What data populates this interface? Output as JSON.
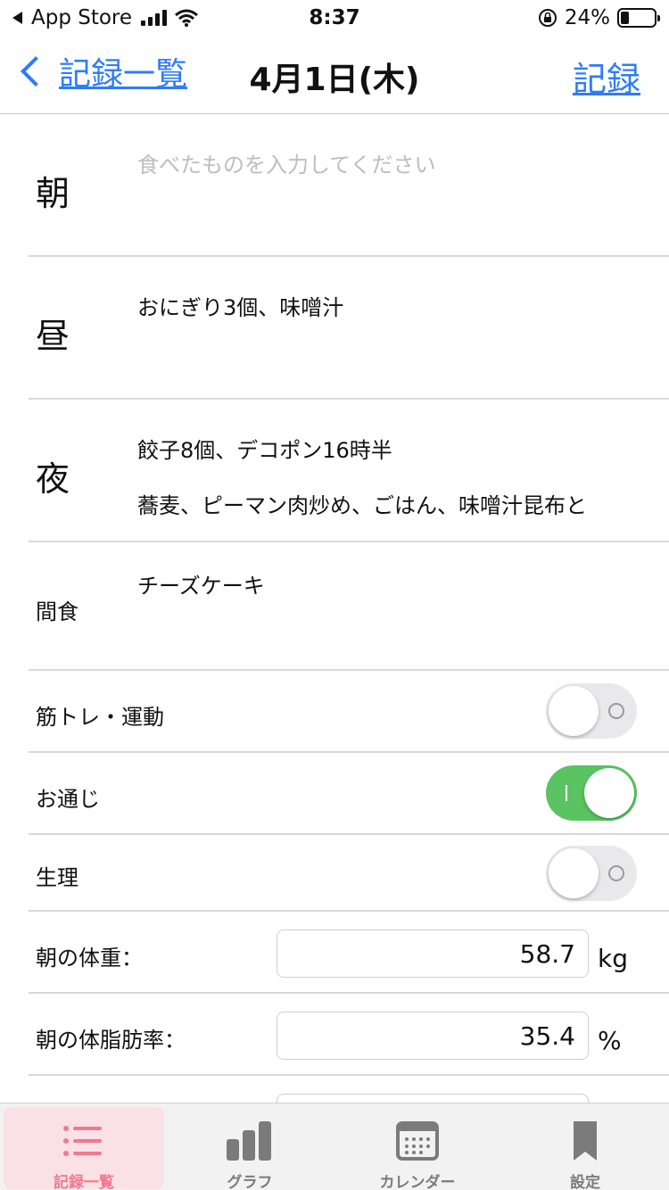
{
  "status_bar": {
    "carrier": "App Store",
    "time": "8:37",
    "battery_percent": "24%",
    "battery_level": 0.24
  },
  "nav": {
    "back_label": "記録一覧",
    "title": "4月1日(木)",
    "action_label": "記録"
  },
  "meals": [
    {
      "label": "朝",
      "lines": [],
      "placeholder": "食べたものを入力してください"
    },
    {
      "label": "昼",
      "lines": [
        "おにぎり3個、味噌汁"
      ]
    },
    {
      "label": "夜",
      "lines": [
        "餃子8個、デコポン16時半",
        "蕎麦、ピーマン肉炒め、ごはん、味噌汁昆布と"
      ]
    },
    {
      "label": "間食",
      "lines": [
        "チーズケーキ"
      ]
    }
  ],
  "toggles": [
    {
      "label": "筋トレ・運動",
      "on": false
    },
    {
      "label": "お通じ",
      "on": true
    },
    {
      "label": "生理",
      "on": false
    }
  ],
  "measurements": [
    {
      "label": "朝の体重：",
      "value": "58.7",
      "unit": "kg"
    },
    {
      "label": "朝の体脂肪率：",
      "value": "35.4",
      "unit": "%"
    }
  ],
  "tabs": [
    {
      "label": "記録一覧",
      "icon": "list-icon",
      "active": true
    },
    {
      "label": "グラフ",
      "icon": "bar-chart-icon",
      "active": false
    },
    {
      "label": "カレンダー",
      "icon": "calendar-icon",
      "active": false
    },
    {
      "label": "設定",
      "icon": "bookmark-icon",
      "active": false
    }
  ],
  "colors": {
    "accent_blue": "#2f7cf6",
    "toggle_on_green": "#5ac463",
    "tab_active_pink": "#f2788f"
  }
}
